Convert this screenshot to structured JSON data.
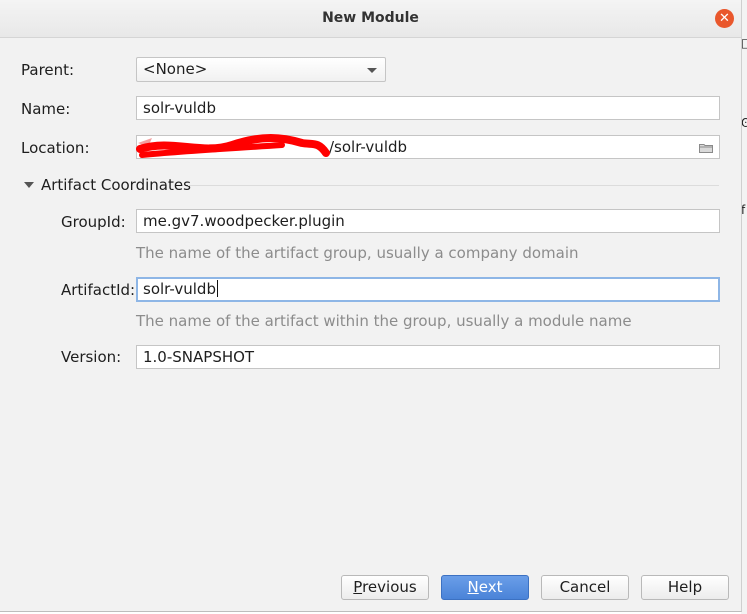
{
  "dialog": {
    "title": "New Module",
    "close_symbol": "✕"
  },
  "form": {
    "parent": {
      "label": "Parent:",
      "value": "<None>"
    },
    "name": {
      "label": "Name:",
      "value": "solr-vuldb"
    },
    "location": {
      "label": "Location:",
      "value_visible": "/solr-vuldb",
      "redacted": true
    }
  },
  "artifact": {
    "section_title": "Artifact Coordinates",
    "groupid": {
      "label": "GroupId:",
      "value": "me.gv7.woodpecker.plugin",
      "hint": "The name of the artifact group, usually a company domain"
    },
    "artifactid": {
      "label": "ArtifactId:",
      "value": "solr-vuldb",
      "hint": "The name of the artifact within the group, usually a module name"
    },
    "version": {
      "label": "Version:",
      "value": "1.0-SNAPSHOT"
    }
  },
  "buttons": {
    "previous": {
      "mnemonic": "P",
      "rest": "revious"
    },
    "next": {
      "mnemonic": "N",
      "rest": "ext"
    },
    "cancel": "Cancel",
    "help": "Help"
  },
  "colors": {
    "primary_button": "#4a83d8",
    "close_button": "#e9572c",
    "redaction": "#ff0000",
    "focus_border": "#8eb6e6"
  }
}
